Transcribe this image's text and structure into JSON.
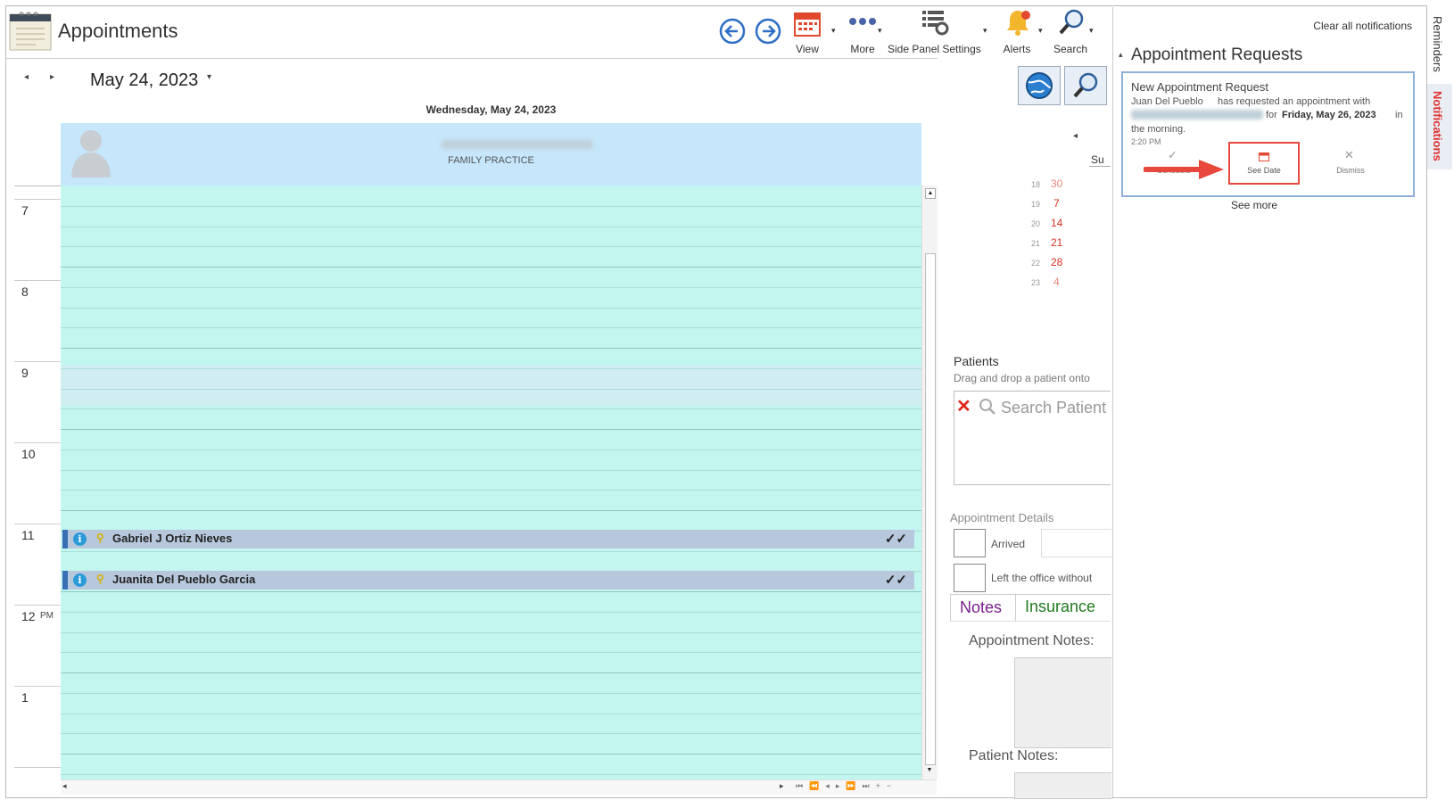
{
  "app": {
    "title": "Appointments"
  },
  "toolbar": {
    "view_label": "View",
    "more_label": "More",
    "side_panel_label": "Side Panel Settings",
    "alerts_label": "Alerts",
    "search_label": "Search"
  },
  "calendar": {
    "date_title": "May 24, 2023",
    "day_header": "Wednesday, May 24, 2023",
    "resource_name": "FAMILY PRACTICE",
    "hours": [
      {
        "label": "7",
        "suffix": ""
      },
      {
        "label": "8",
        "suffix": ""
      },
      {
        "label": "9",
        "suffix": ""
      },
      {
        "label": "10",
        "suffix": ""
      },
      {
        "label": "11",
        "suffix": ""
      },
      {
        "label": "12",
        "suffix": "PM"
      },
      {
        "label": "1",
        "suffix": ""
      }
    ],
    "appointments": [
      {
        "name": "Gabriel J Ortiz Nieves",
        "status": "✓✓"
      },
      {
        "name": "Juanita Del Pueblo Garcia",
        "status": "✓✓"
      }
    ]
  },
  "mini_calendar": {
    "day_header": "Su",
    "weeks": [
      {
        "week": "18",
        "day": "30"
      },
      {
        "week": "19",
        "day": "7"
      },
      {
        "week": "20",
        "day": "14"
      },
      {
        "week": "21",
        "day": "21"
      },
      {
        "week": "22",
        "day": "28"
      },
      {
        "week": "23",
        "day": "4"
      }
    ]
  },
  "patients": {
    "title": "Patients",
    "hint": "Drag and drop a patient onto",
    "search_placeholder": "Search Patient"
  },
  "appointment_details": {
    "title": "Appointment Details",
    "arrived_label": "Arrived",
    "left_label": "Left the office without",
    "tab_notes": "Notes",
    "tab_insurance": "Insurance",
    "appointment_notes_label": "Appointment Notes:",
    "patient_notes_label": "Patient Notes:"
  },
  "notifications": {
    "clear_all": "Clear all notifications",
    "section_title": "Appointment Requests",
    "card": {
      "title": "New Appointment Request",
      "line1_name": "Juan  Del Pueblo",
      "line1_rest": "has requested an appointment with",
      "line2_prefix": "for",
      "line2_date": "Friday, May 26, 2023",
      "line2_suffix": "in",
      "line3": "the morning.",
      "time": "2:20 PM",
      "schedule_label": "Schedule",
      "see_date_label": "See Date",
      "dismiss_label": "Dismiss"
    },
    "see_more": "See more"
  },
  "side_tabs": {
    "reminders": "Reminders",
    "notifications": "Notifications"
  },
  "colors": {
    "grid_bg": "#c2f6ef",
    "header_bg": "#c5e6fb",
    "appointment_bg": "#b8c8dc",
    "highlight_red": "#e8473b",
    "notifications_tab": "#e03030",
    "notes_tab": "#7a1f8c",
    "insurance_tab": "#1f7a1f"
  }
}
